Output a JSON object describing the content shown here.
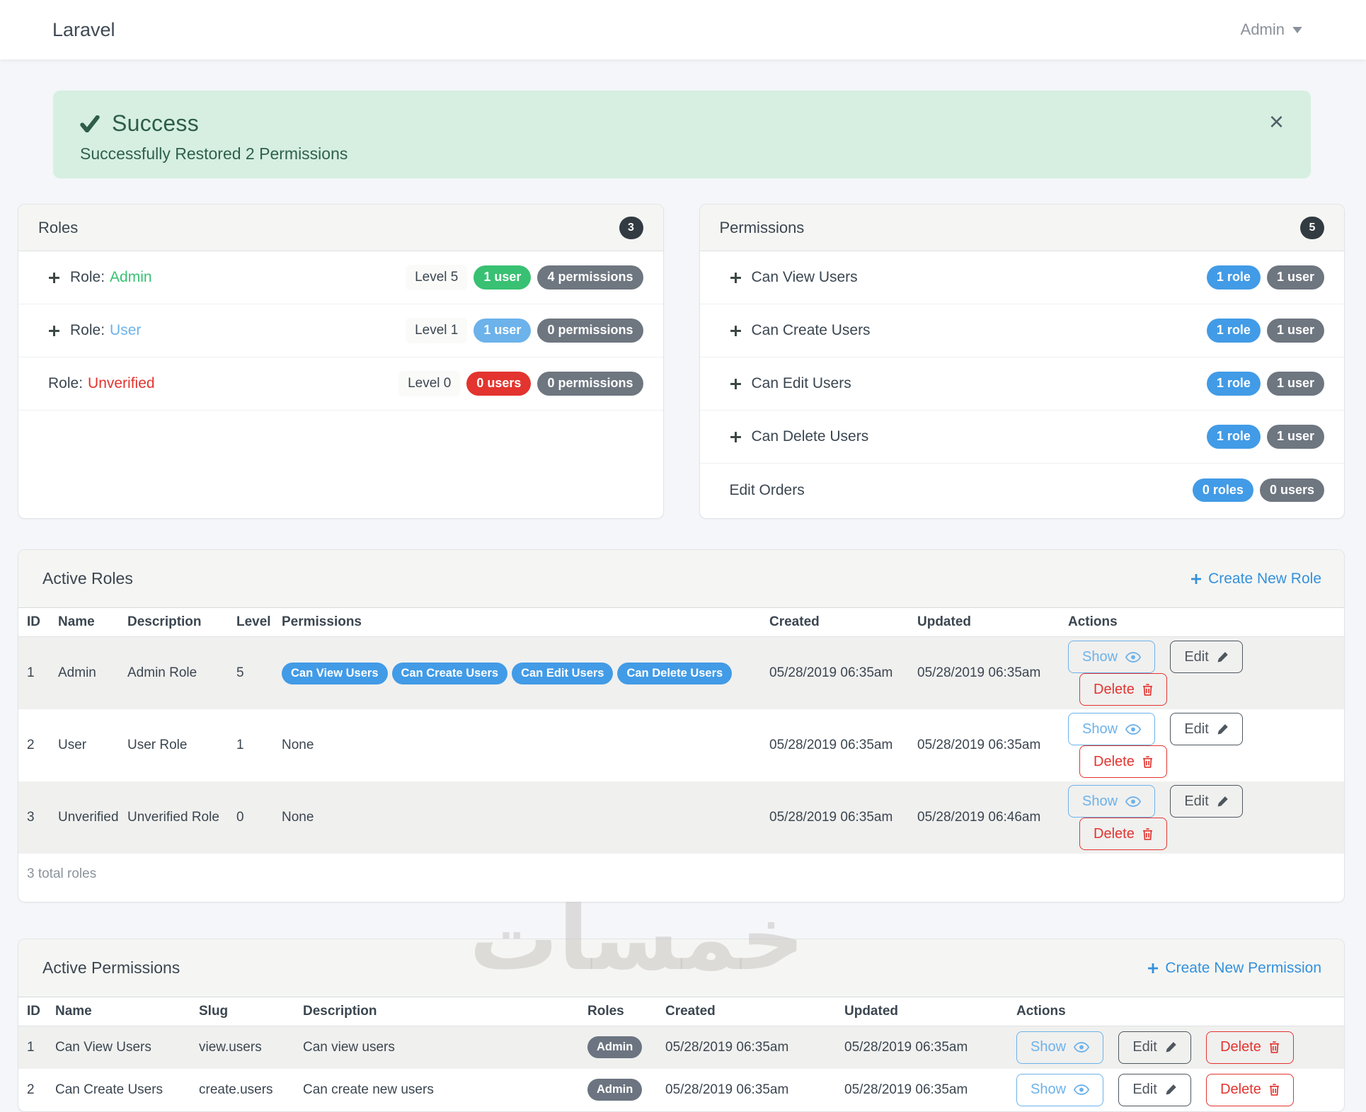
{
  "navbar": {
    "brand": "Laravel",
    "user": "Admin"
  },
  "alert": {
    "title": "Success",
    "message": "Successfully Restored 2 Permissions",
    "close": "×"
  },
  "roles_card": {
    "title": "Roles",
    "count": "3",
    "rows": [
      {
        "label": "Role:",
        "name": "Admin",
        "level": "Level 5",
        "users": "1 user",
        "permissions": "4 permissions"
      },
      {
        "label": "Role:",
        "name": "User",
        "level": "Level 1",
        "users": "1 user",
        "permissions": "0 permissions"
      },
      {
        "label": "Role:",
        "name": "Unverified",
        "level": "Level 0",
        "users": "0 users",
        "permissions": "0 permissions"
      }
    ]
  },
  "permissions_card": {
    "title": "Permissions",
    "count": "5",
    "rows": [
      {
        "name": "Can View Users",
        "roles": "1 role",
        "users": "1 user"
      },
      {
        "name": "Can Create Users",
        "roles": "1 role",
        "users": "1 user"
      },
      {
        "name": "Can Edit Users",
        "roles": "1 role",
        "users": "1 user"
      },
      {
        "name": "Can Delete Users",
        "roles": "1 role",
        "users": "1 user"
      },
      {
        "name": "Edit Orders",
        "roles": "0 roles",
        "users": "0 users"
      }
    ]
  },
  "actions": {
    "show": "Show",
    "edit": "Edit",
    "delete": "Delete"
  },
  "active_roles": {
    "title": "Active Roles",
    "create_label": "Create New Role",
    "columns": [
      "ID",
      "Name",
      "Description",
      "Level",
      "Permissions",
      "Created",
      "Updated",
      "Actions"
    ],
    "rows": [
      {
        "id": "1",
        "name": "Admin",
        "description": "Admin Role",
        "level": "5",
        "permissions": [
          "Can View Users",
          "Can Create Users",
          "Can Edit Users",
          "Can Delete Users"
        ],
        "created": "05/28/2019 06:35am",
        "updated": "05/28/2019 06:35am"
      },
      {
        "id": "2",
        "name": "User",
        "description": "User Role",
        "level": "1",
        "permissions_label": "None",
        "created": "05/28/2019 06:35am",
        "updated": "05/28/2019 06:35am"
      },
      {
        "id": "3",
        "name": "Unverified",
        "description": "Unverified Role",
        "level": "0",
        "permissions_label": "None",
        "created": "05/28/2019 06:35am",
        "updated": "05/28/2019 06:46am"
      }
    ],
    "footer": "3 total roles"
  },
  "active_permissions": {
    "title": "Active Permissions",
    "create_label": "Create New Permission",
    "columns": [
      "ID",
      "Name",
      "Slug",
      "Description",
      "Roles",
      "Created",
      "Updated",
      "Actions"
    ],
    "rows": [
      {
        "id": "1",
        "name": "Can View Users",
        "slug": "view.users",
        "description": "Can view users",
        "role": "Admin",
        "created": "05/28/2019 06:35am",
        "updated": "05/28/2019 06:35am"
      },
      {
        "id": "2",
        "name": "Can Create Users",
        "slug": "create.users",
        "description": "Can create new users",
        "role": "Admin",
        "created": "05/28/2019 06:35am",
        "updated": "05/28/2019 06:35am"
      }
    ]
  },
  "watermark": "خمسات",
  "colors": {
    "green": "#38c172",
    "light_blue": "#6cb2eb",
    "blue": "#429be6",
    "gray": "#6e7680",
    "red": "#e3342f",
    "dark_badge": "#333b42",
    "link_blue": "#3490dc",
    "alert_bg": "#d6efe1",
    "alert_text": "#2e5d49"
  }
}
